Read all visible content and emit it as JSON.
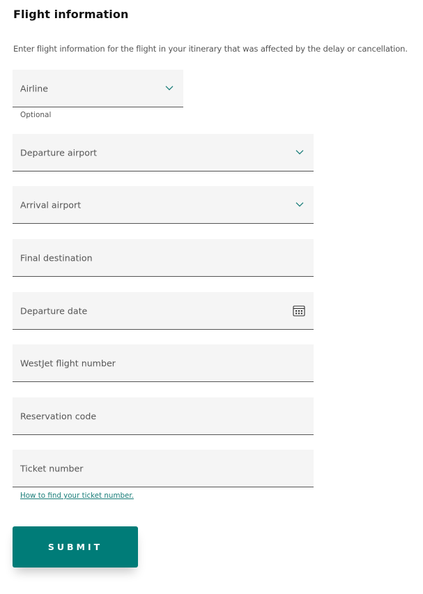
{
  "section": {
    "title": "Flight information",
    "description": "Enter flight information for the flight in your itinerary that was affected by the delay or cancellation."
  },
  "fields": {
    "airline": {
      "label": "Airline",
      "helper": "Optional",
      "icon": "chevron-down-icon"
    },
    "departure_airport": {
      "label": "Departure airport",
      "icon": "chevron-down-icon"
    },
    "arrival_airport": {
      "label": "Arrival airport",
      "icon": "chevron-down-icon"
    },
    "final_destination": {
      "label": "Final destination"
    },
    "departure_date": {
      "label": "Departure date",
      "icon": "calendar-icon"
    },
    "flight_number": {
      "label": "WestJet flight number"
    },
    "reservation_code": {
      "label": "Reservation code"
    },
    "ticket_number": {
      "label": "Ticket number",
      "help_link": "How to find your ticket number."
    }
  },
  "actions": {
    "submit_label": "SUBMIT"
  },
  "colors": {
    "accent": "#007c78",
    "link": "#1b7e7a",
    "field_bg": "#f5f5f5"
  }
}
